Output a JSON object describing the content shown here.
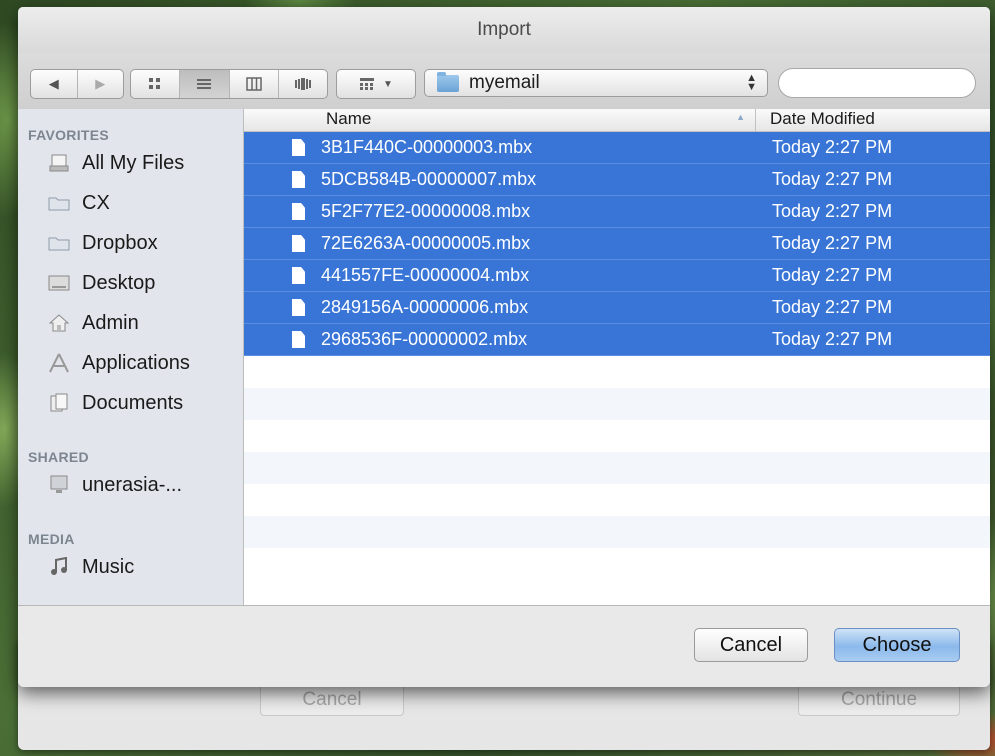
{
  "dialog": {
    "title": "Import",
    "path": "myemail",
    "search_placeholder": ""
  },
  "sidebar": {
    "favorites_header": "FAVORITES",
    "favorites": [
      {
        "label": "All My Files",
        "icon": "all-files-icon"
      },
      {
        "label": "CX",
        "icon": "folder-icon"
      },
      {
        "label": "Dropbox",
        "icon": "folder-icon"
      },
      {
        "label": "Desktop",
        "icon": "desktop-icon"
      },
      {
        "label": "Admin",
        "icon": "home-icon"
      },
      {
        "label": "Applications",
        "icon": "applications-icon"
      },
      {
        "label": "Documents",
        "icon": "documents-icon"
      }
    ],
    "shared_header": "SHARED",
    "shared": [
      {
        "label": "unerasia-...",
        "icon": "monitor-icon"
      }
    ],
    "media_header": "MEDIA",
    "media": [
      {
        "label": "Music",
        "icon": "music-icon"
      }
    ]
  },
  "columns": {
    "name": "Name",
    "date": "Date Modified"
  },
  "files": [
    {
      "name": "3B1F440C-00000003.mbx",
      "date": "Today 2:27 PM"
    },
    {
      "name": "5DCB584B-00000007.mbx",
      "date": "Today 2:27 PM"
    },
    {
      "name": "5F2F77E2-00000008.mbx",
      "date": "Today 2:27 PM"
    },
    {
      "name": "72E6263A-00000005.mbx",
      "date": "Today 2:27 PM"
    },
    {
      "name": "441557FE-00000004.mbx",
      "date": "Today 2:27 PM"
    },
    {
      "name": "2849156A-00000006.mbx",
      "date": "Today 2:27 PM"
    },
    {
      "name": "2968536F-00000002.mbx",
      "date": "Today 2:27 PM"
    }
  ],
  "buttons": {
    "cancel": "Cancel",
    "choose": "Choose"
  },
  "underlying": {
    "cancel": "Cancel",
    "continue": "Continue"
  },
  "colors": {
    "selection": "#3875d7",
    "sidebar_bg": "#e2e6ec"
  }
}
